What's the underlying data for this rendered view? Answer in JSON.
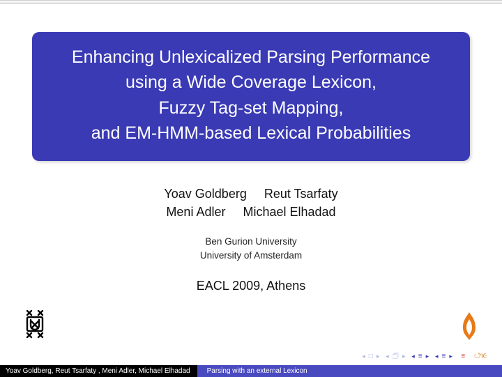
{
  "title": {
    "line1": "Enhancing Unlexicalized Parsing Performance",
    "line2": "using a Wide Coverage Lexicon,",
    "line3": "Fuzzy Tag-set Mapping,",
    "line4": "and EM-HMM-based Lexical Probabilities"
  },
  "authors": {
    "row1": {
      "a": "Yoav Goldberg",
      "b": "Reut Tsarfaty"
    },
    "row2": {
      "a": "Meni Adler",
      "b": "Michael Elhadad"
    }
  },
  "orgs": {
    "a": "Ben Gurion University",
    "b": "University of Amsterdam"
  },
  "venue": "EACL 2009, Athens",
  "footer": {
    "authors": "Yoav Goldberg, Reut Tsarfaty , Meni Adler, Michael Elhadad",
    "short_title": "Parsing with an external Lexicon"
  }
}
